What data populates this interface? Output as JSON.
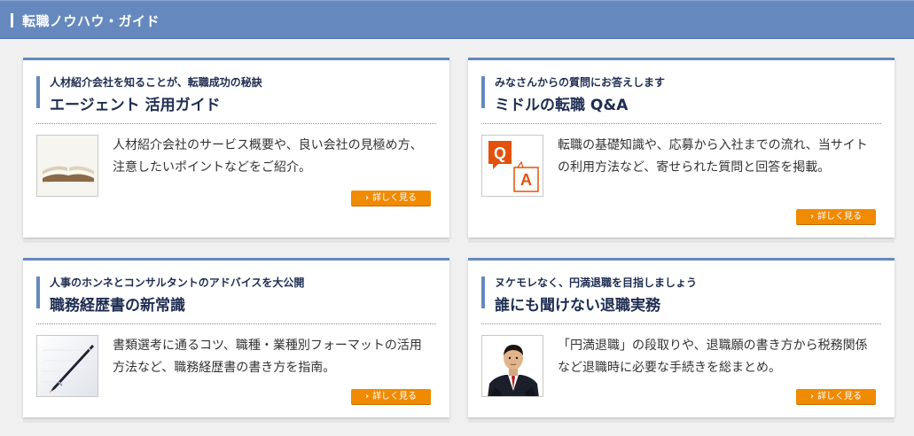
{
  "header": {
    "title": "転職ノウハウ・ガイド"
  },
  "cards": [
    {
      "subtitle": "人材紹介会社を知ることが、転職成功の秘訣",
      "title": "エージェント 活用ガイド",
      "description": "人材紹介会社のサービス概要や、良い会社の見極め方、注意したいポイントなどをご紹介。",
      "button_label": "詳しく見る",
      "thumbnail_icon": "book-icon"
    },
    {
      "subtitle": "みなさんからの質問にお答えします",
      "title": "ミドルの転職 Q&A",
      "description": "転職の基礎知識や、応募から入社までの流れ、当サイトの利用方法など、寄せられた質問と回答を掲載。",
      "button_label": "詳しく見る",
      "thumbnail_icon": "qa-icon",
      "thumbnail_text": {
        "q": "Q",
        "a": "A"
      }
    },
    {
      "subtitle": "人事のホンネとコンサルタントのアドバイスを大公開",
      "title": "職務経歴書の新常識",
      "description": "書類選考に通るコツ、職種・業種別フォーマットの活用方法など、職務経歴書の書き方を指南。",
      "button_label": "詳しく見る",
      "thumbnail_icon": "pen-icon"
    },
    {
      "subtitle": "ヌケモレなく、円満退職を目指しましょう",
      "title": "誰にも聞けない退職実務",
      "description": "「円満退職」の段取りや、退職願の書き方から税務関係など退職時に必要な手続きを総まとめ。",
      "button_label": "詳しく見る",
      "thumbnail_icon": "businessman-photo"
    }
  ],
  "colors": {
    "accent": "#6589bf",
    "button": "#f08a00",
    "title_text": "#1e2d52"
  }
}
